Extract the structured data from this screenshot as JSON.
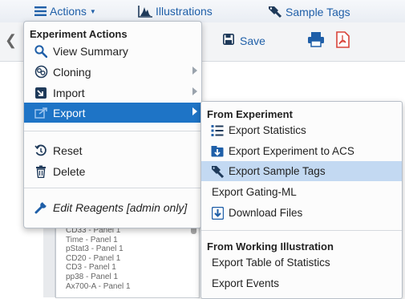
{
  "topbar": {
    "actions_label": "Actions",
    "illustrations_label": "Illustrations",
    "sample_tags_label": "Sample Tags"
  },
  "toolbar": {
    "save_label": "Save"
  },
  "background_list": [
    "CD33 - Panel 1",
    "Time - Panel 1",
    "pStat3 - Panel 1",
    "CD20 - Panel 1",
    "CD3 - Panel 1",
    "pp38 - Panel 1",
    "Ax700-A - Panel 1"
  ],
  "menu": {
    "header": "Experiment Actions",
    "items": [
      {
        "label": "View Summary",
        "icon": "magnifier-icon"
      },
      {
        "label": "Cloning",
        "icon": "cloning-icon",
        "submenu": true
      },
      {
        "label": "Import",
        "icon": "import-icon",
        "submenu": true
      },
      {
        "label": "Export",
        "icon": "export-icon",
        "submenu": true,
        "active": true
      },
      {
        "label": "Reset",
        "icon": "reset-icon"
      },
      {
        "label": "Delete",
        "icon": "trash-icon"
      },
      {
        "label": "Edit Reagents [admin only]",
        "icon": "wrench-icon"
      }
    ]
  },
  "submenu": {
    "header_experiment": "From Experiment",
    "header_illustration": "From Working Illustration",
    "items": [
      {
        "label": "Export Statistics",
        "icon": "statistics-icon"
      },
      {
        "label": "Export Experiment to ACS",
        "icon": "acs-export-icon"
      },
      {
        "label": "Export Sample Tags",
        "icon": "tags-icon",
        "hover": true
      },
      {
        "label": "Export Gating-ML"
      },
      {
        "label": "Download Files",
        "icon": "download-icon"
      },
      {
        "label": "Export Table of Statistics"
      },
      {
        "label": "Export Events"
      }
    ]
  },
  "colors": {
    "accent": "#1e74c6",
    "link": "#1f5fa8",
    "hover": "#c3d9f2",
    "pdf": "#d9443a"
  }
}
